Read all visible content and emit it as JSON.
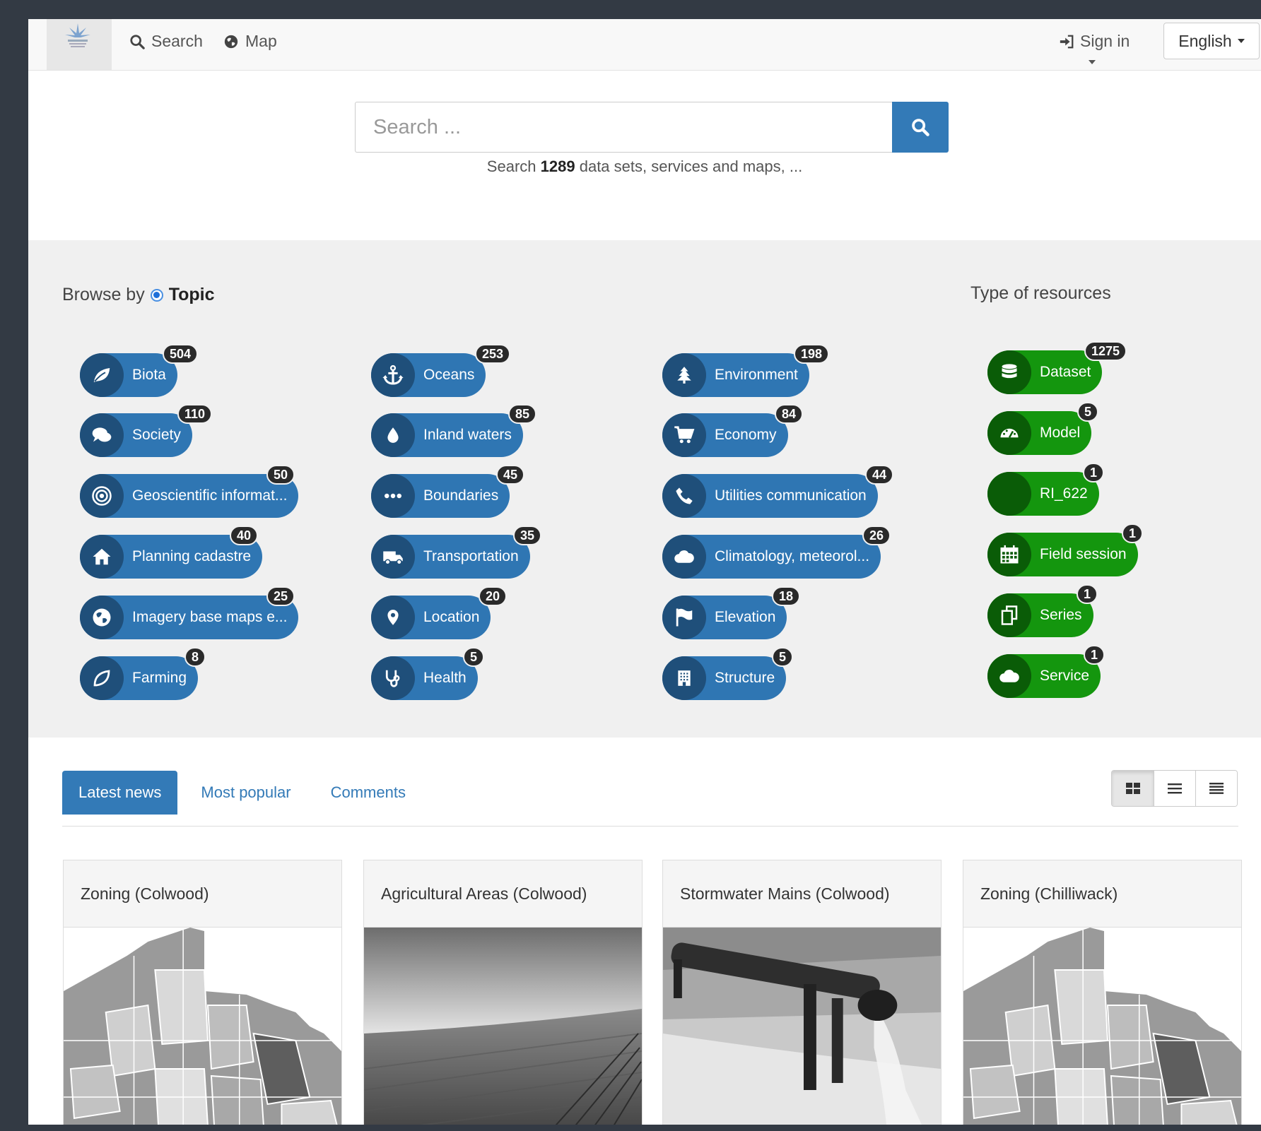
{
  "navbar": {
    "search_label": "Search",
    "map_label": "Map",
    "signin_label": "Sign in",
    "language": "English"
  },
  "search": {
    "placeholder": "Search ...",
    "hint_prefix": "Search",
    "hint_count": "1289",
    "hint_suffix": "data sets, services and maps, ..."
  },
  "browse": {
    "title_prefix": "Browse by",
    "title_option": "Topic",
    "type_title": "Type of resources",
    "topics": [
      {
        "label": "Biota",
        "count": "504",
        "icon": "leaf-icon"
      },
      {
        "label": "Society",
        "count": "110",
        "icon": "comments-icon"
      },
      {
        "label": "Geoscientific informat...",
        "count": "50",
        "icon": "target-icon"
      },
      {
        "label": "Planning cadastre",
        "count": "40",
        "icon": "home-icon"
      },
      {
        "label": "Imagery base maps e...",
        "count": "25",
        "icon": "globe-icon"
      },
      {
        "label": "Farming",
        "count": "8",
        "icon": "leaf-outline-icon"
      },
      {
        "label": "Oceans",
        "count": "253",
        "icon": "anchor-icon"
      },
      {
        "label": "Inland waters",
        "count": "85",
        "icon": "water-drop-icon"
      },
      {
        "label": "Boundaries",
        "count": "45",
        "icon": "ellipsis-icon"
      },
      {
        "label": "Transportation",
        "count": "35",
        "icon": "truck-icon"
      },
      {
        "label": "Location",
        "count": "20",
        "icon": "map-pin-icon"
      },
      {
        "label": "Health",
        "count": "5",
        "icon": "stethoscope-icon"
      },
      {
        "label": "Environment",
        "count": "198",
        "icon": "tree-icon"
      },
      {
        "label": "Economy",
        "count": "84",
        "icon": "shopping-cart-icon"
      },
      {
        "label": "Utilities communication",
        "count": "44",
        "icon": "phone-icon"
      },
      {
        "label": "Climatology, meteorol...",
        "count": "26",
        "icon": "cloud-icon"
      },
      {
        "label": "Elevation",
        "count": "18",
        "icon": "flag-icon"
      },
      {
        "label": "Structure",
        "count": "5",
        "icon": "building-icon"
      }
    ],
    "resource_types": [
      {
        "label": "Dataset",
        "count": "1275",
        "icon": "database-icon"
      },
      {
        "label": "Model",
        "count": "5",
        "icon": "dashboard-icon"
      },
      {
        "label": "RI_622",
        "count": "1",
        "icon": "blank-icon"
      },
      {
        "label": "Field session",
        "count": "1",
        "icon": "calendar-icon"
      },
      {
        "label": "Series",
        "count": "1",
        "icon": "copy-icon"
      },
      {
        "label": "Service",
        "count": "1",
        "icon": "cloud-icon"
      }
    ]
  },
  "tabs": [
    {
      "label": "Latest news",
      "active": true
    },
    {
      "label": "Most popular",
      "active": false
    },
    {
      "label": "Comments",
      "active": false
    }
  ],
  "cards": [
    {
      "title": "Zoning (Colwood)"
    },
    {
      "title": "Agricultural Areas (Colwood)"
    },
    {
      "title": "Stormwater Mains (Colwood)"
    },
    {
      "title": "Zoning (Chilliwack)"
    }
  ],
  "colors": {
    "primary": "#337ab7",
    "topic_pill": "#2f76b3",
    "resource_pill": "#14960e",
    "badge": "#2a2a2a"
  }
}
